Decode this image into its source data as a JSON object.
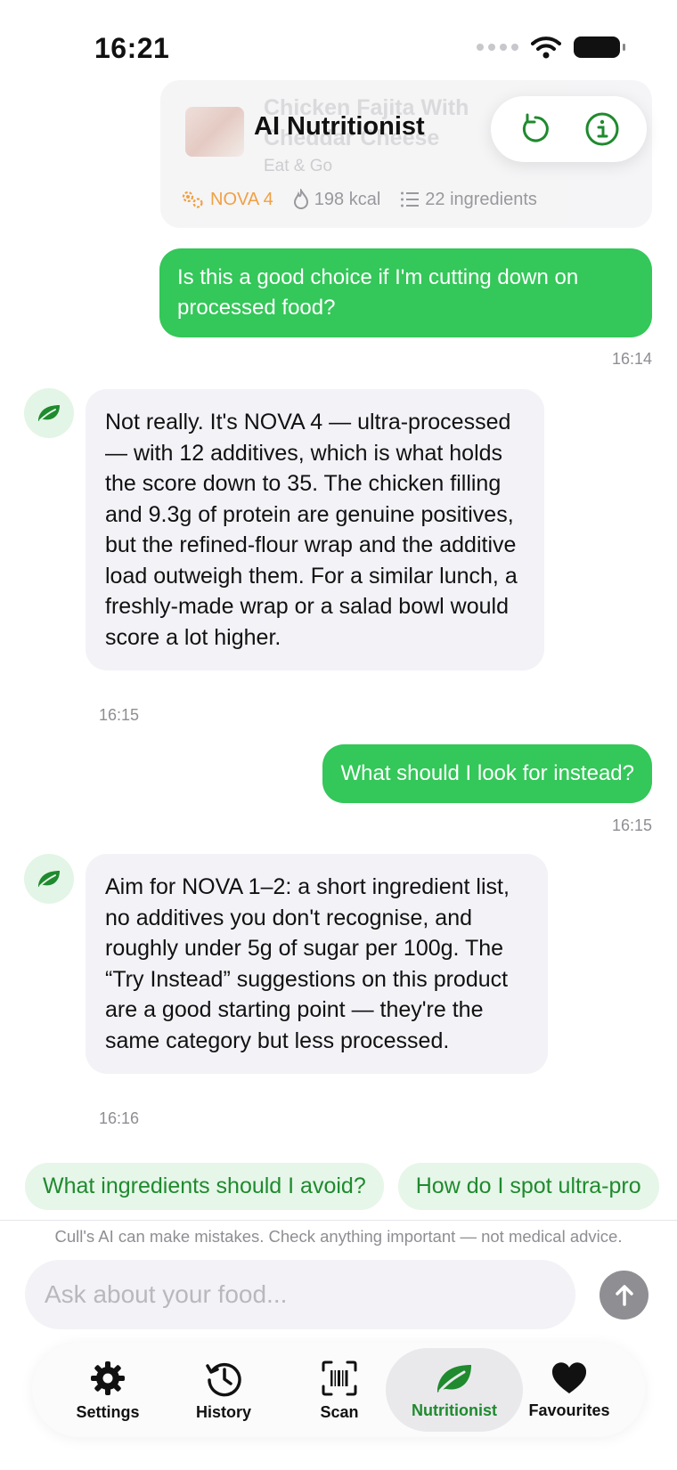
{
  "status_bar": {
    "time": "16:21"
  },
  "product": {
    "name": "Chicken Fajita With Cheddar Cheese",
    "brand": "Eat & Go",
    "nova": "NOVA 4",
    "kcal": "198 kcal",
    "ingredients": "22 ingredients"
  },
  "header": {
    "title": "AI Nutritionist"
  },
  "messages": [
    {
      "role": "user",
      "text": "Is this a good choice if I'm cutting down on processed food?",
      "time": "16:14"
    },
    {
      "role": "assistant",
      "text": "Not really. It's NOVA 4 — ultra-processed — with 12 additives, which is what holds the score down to 35. The chicken filling and 9.3g of protein are genuine positives, but the refined-flour wrap and the additive load outweigh them. For a similar lunch, a freshly-made wrap or a salad bowl would score a lot higher.",
      "time": "16:15"
    },
    {
      "role": "user",
      "text": "What should I look for instead?",
      "time": "16:15"
    },
    {
      "role": "assistant",
      "text": "Aim for NOVA 1–2: a short ingredient list, no additives you don't recognise, and roughly under 5g of sugar per 100g. The “Try Instead” suggestions on this product are a good starting point — they're the same category but less processed.",
      "time": "16:16"
    }
  ],
  "suggestions": [
    "What ingredients should I avoid?",
    "How do I spot ultra-pro"
  ],
  "disclaimer": "Cull's AI can make mistakes. Check anything important — not medical advice.",
  "composer": {
    "placeholder": "Ask about your food..."
  },
  "tabs": [
    {
      "label": "Settings",
      "icon": "gear-icon"
    },
    {
      "label": "History",
      "icon": "history-icon"
    },
    {
      "label": "Scan",
      "icon": "barcode-scan-icon"
    },
    {
      "label": "Nutritionist",
      "icon": "leaf-icon",
      "active": true
    },
    {
      "label": "Favourites",
      "icon": "heart-icon"
    }
  ],
  "colors": {
    "accent": "#34c759",
    "accent_dark": "#1f8a2e",
    "nova": "#f0962e",
    "bot_bubble": "#f2f2f7"
  }
}
